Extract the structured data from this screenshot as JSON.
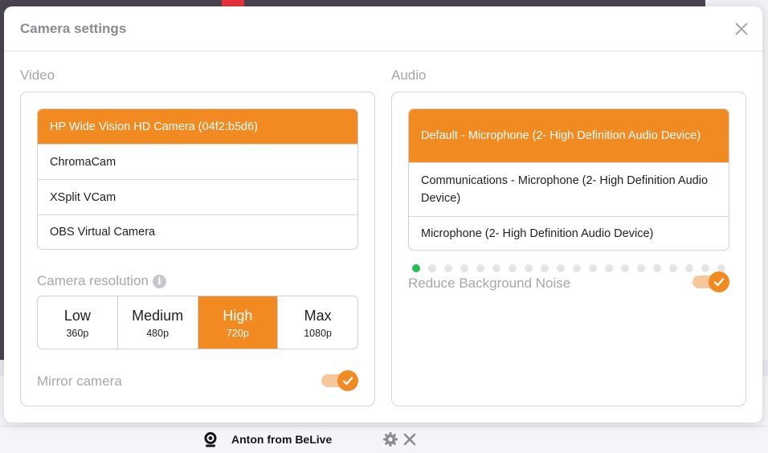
{
  "modal": {
    "title": "Camera settings"
  },
  "video": {
    "section_title": "Video",
    "devices": [
      {
        "label": "HP Wide Vision HD Camera (04f2:b5d6)",
        "selected": true
      },
      {
        "label": "ChromaCam",
        "selected": false
      },
      {
        "label": "XSplit VCam",
        "selected": false
      },
      {
        "label": "OBS Virtual Camera",
        "selected": false
      }
    ],
    "resolution_label": "Camera resolution",
    "resolutions": [
      {
        "name": "Low",
        "value": "360p",
        "selected": false
      },
      {
        "name": "Medium",
        "value": "480p",
        "selected": false
      },
      {
        "name": "High",
        "value": "720p",
        "selected": true
      },
      {
        "name": "Max",
        "value": "1080p",
        "selected": false
      }
    ],
    "mirror_label": "Mirror camera",
    "mirror_on": true
  },
  "audio": {
    "section_title": "Audio",
    "devices": [
      {
        "label": "Default - Microphone (2- High Definition Audio Device)",
        "selected": true
      },
      {
        "label": "Communications - Microphone (2- High Definition Audio Device)",
        "selected": false
      },
      {
        "label": "Microphone (2- High Definition Audio Device)",
        "selected": false
      }
    ],
    "level_meter": {
      "total_dots": 20,
      "active_dots": 1
    },
    "noise_label": "Reduce Background Noise",
    "noise_on": true
  },
  "footer": {
    "camera_source_name": "Anton from BeLive"
  },
  "colors": {
    "accent": "#f28a22",
    "accent_light": "#f6c79a",
    "level_active": "#22c04e"
  }
}
